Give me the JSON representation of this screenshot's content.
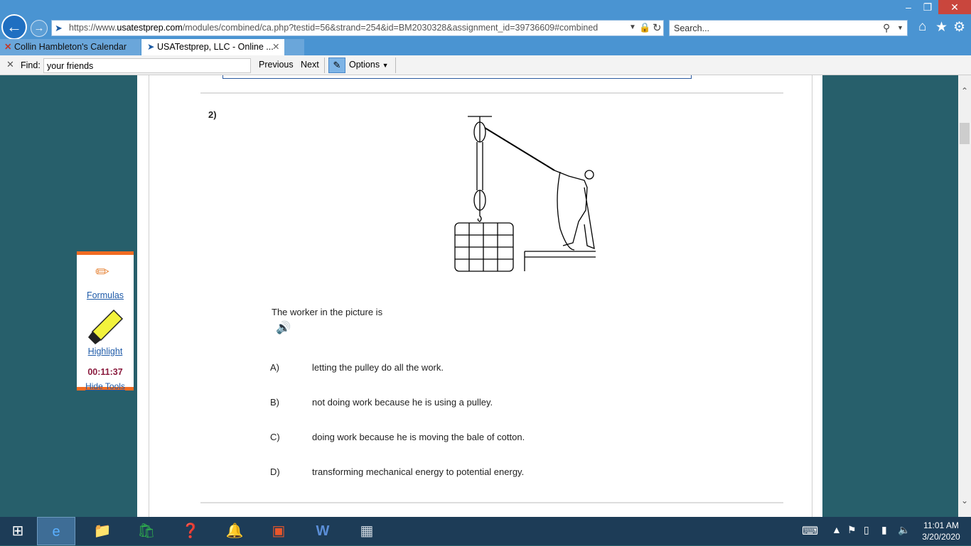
{
  "browser": {
    "url_prefix": "https://www.",
    "url_domain": "usatestprep.com",
    "url_rest": "/modules/combined/ca.php?testid=56&strand=254&id=BM2030328&assignment_id=39736609#combined",
    "search_placeholder": "Search...",
    "tabs": [
      {
        "label": "Collin Hambleton's Calendar"
      },
      {
        "label": "USATestprep, LLC - Online ..."
      }
    ]
  },
  "find_bar": {
    "label": "Find:",
    "query": "your friends",
    "previous": "Previous",
    "next": "Next",
    "options": "Options"
  },
  "question": {
    "number": "2)",
    "prompt": "The worker in the picture is",
    "options": [
      {
        "label": "A)",
        "text": "letting the pulley do all the work."
      },
      {
        "label": "B)",
        "text": "not doing work because he is using a pulley."
      },
      {
        "label": "C)",
        "text": "doing work because he is moving the bale of cotton."
      },
      {
        "label": "D)",
        "text": "transforming mechanical energy to potential energy."
      }
    ]
  },
  "tools": {
    "formulas": "Formulas",
    "highlight": "Highlight",
    "timer": "00:11:37",
    "hide": "Hide Tools"
  },
  "taskbar": {
    "time": "11:01 AM",
    "date": "3/20/2020"
  },
  "colors": {
    "accent": "#f26b21",
    "background": "#275f6b",
    "link": "#1e5aa8",
    "timer": "#8b1c3f"
  }
}
